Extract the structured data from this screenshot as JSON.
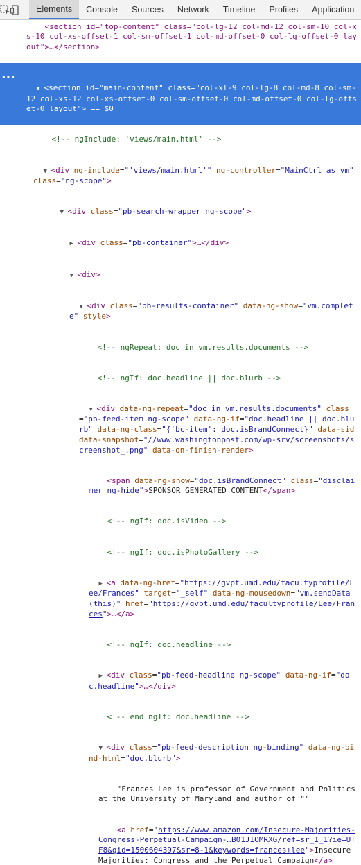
{
  "toolbar": {
    "tabs": [
      "Elements",
      "Console",
      "Sources",
      "Network",
      "Timeline",
      "Profiles",
      "Application"
    ],
    "active_tab": "Elements"
  },
  "code": {
    "l1": "<section id=\"top-content\" class=\"col-lg-12 col-md-12 col-sm-10 col-xs-10 col-xs-offset-1 col-sm-offset-1 col-md-offset-0 col-lg-offset-0 layout\">…</section>",
    "l2_tag_open": "<section",
    "l2_id_attr": "id",
    "l2_id_val": "\"main-content\"",
    "l2_class_attr": "class",
    "l2_class_val": "\"col-xl-9 col-lg-8 col-md-8 col-sm-12 col-xs-12 col-xs-offset-0 col-sm-offset-0 col-md-offset-0 col-lg-offset-0 layout\"",
    "l2_tail": "> == $0",
    "l3": "<!-- ngInclude: 'views/main.html' -->",
    "l4_a": "<div",
    "l4_b": "ng-include",
    "l4_c": "\"'views/main.html'\"",
    "l4_d": "ng-controller",
    "l4_e": "\"MainCtrl as vm\"",
    "l4_f": "class",
    "l4_g": "\"ng-scope\"",
    "l5_a": "<div",
    "l5_b": "class",
    "l5_c": "\"pb-search-wrapper ng-scope\"",
    "l6_a": "<div",
    "l6_b": "class",
    "l6_c": "\"pb-container\"",
    "l6_d": ">…</div>",
    "l7": "<div>",
    "l8_a": "<div",
    "l8_b": "class",
    "l8_c": "\"pb-results-container\"",
    "l8_d": "data-ng-show",
    "l8_e": "\"vm.complete\"",
    "l8_f": "style",
    "l9": "<!-- ngRepeat: doc in vm.results.documents -->",
    "l10": "<!-- ngIf: doc.headline || doc.blurb -->",
    "l11_a": "<div",
    "l11_b": "data-ng-repeat",
    "l11_c": "\"doc in vm.results.documents\"",
    "l11_d": "class",
    "l11_e": "\"pb-feed-item ng-scope\"",
    "l11_f": "data-ng-if",
    "l11_g": "\"doc.headline || doc.blurb\"",
    "l11_h": "data-ng-class",
    "l11_i": "\"{'bc-item': doc.isBrandConnect}\"",
    "l11_j": "data-sid",
    "l11_k": "data-snapshot",
    "l11_l": "\"//www.washingtonpost.com/wp-srv/screenshots/screenshot_.png\"",
    "l11_m": "data-on-finish-render",
    "l12_a": "<span",
    "l12_b": "data-ng-show",
    "l12_c": "\"doc.isBrandConnect\"",
    "l12_d": "class",
    "l12_e": "\"disclaimer ng-hide\"",
    "l12_f": "SPONSOR GENERATED CONTENT",
    "l12_g": "</span>",
    "l13": "<!-- ngIf: doc.isVideo -->",
    "l14": "<!-- ngIf: doc.isPhotoGallery -->",
    "l15_a": "<a",
    "l15_b": "data-ng-href",
    "l15_c": "\"https://gvpt.umd.edu/facultyprofile/Lee/Frances\"",
    "l15_d": "target",
    "l15_e": "\"_self\"",
    "l15_f": "data-ng-mousedown",
    "l15_g": "\"vm.sendData(this)\"",
    "l15_h": "href",
    "l15_i": "https://gvpt.umd.edu/facultyprofile/Lee/Frances",
    "l15_j": ">…</a>",
    "l16": "<!-- ngIf: doc.headline -->",
    "l17_a": "<div",
    "l17_b": "class",
    "l17_c": "\"pb-feed-headline ng-scope\"",
    "l17_d": "data-ng-if",
    "l17_e": "\"doc.headline\"",
    "l17_f": ">…</div>",
    "l18": "<!-- end ngIf: doc.headline -->",
    "l19_a": "<div",
    "l19_b": "class",
    "l19_c": "\"pb-feed-description ng-binding\"",
    "l19_d": "data-ng-bind-html",
    "l19_e": "\"doc.blurb\"",
    "l20": "\"Frances Lee is professor of Government and Politics at the University of Maryland and author of \"\"",
    "l21_a": "<a",
    "l21_b": "href",
    "l21_c": "https://www.amazon.com/Insecure-Majorities-Congress-Perpetual-Campaign-…B01JIOMRXG/ref=sr_1_1?ie=UTF8&qid=1500604397&sr=8-1&keywords=frances+lee",
    "l21_d": "Insecure Majorities: Congress and the Perpetual Campaign",
    "l21_e": "</a>",
    "l22": "\" \""
  }
}
